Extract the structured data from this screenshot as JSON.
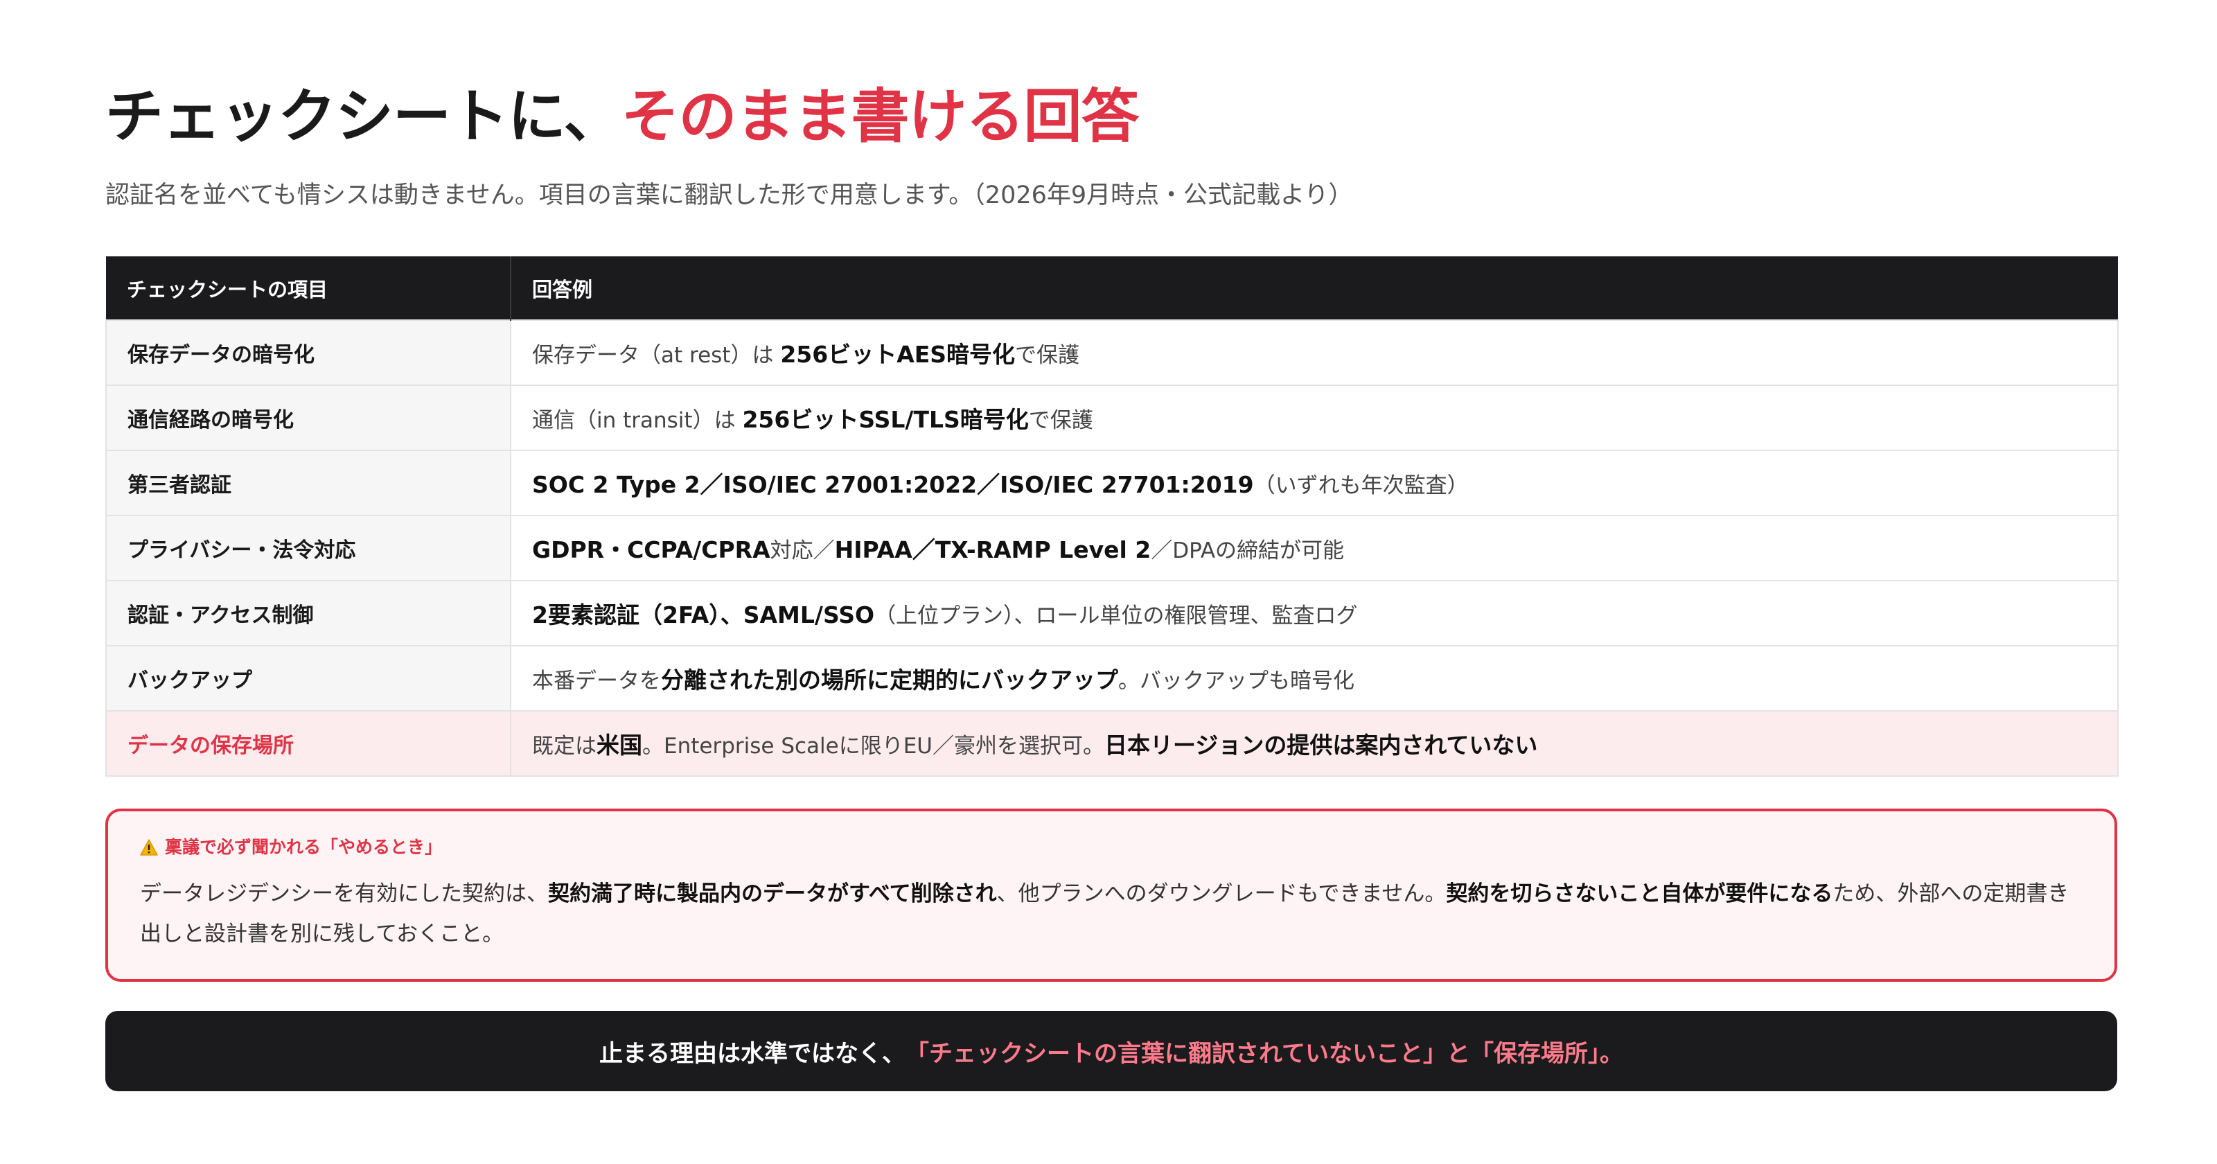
{
  "header": {
    "title_main": "チェックシートに、",
    "title_accent": "そのまま書ける回答",
    "subtitle": "認証名を並べても情シスは動きません。項目の言葉に翻訳した形で用意します。（2026年9月時点・公式記載より）"
  },
  "table": {
    "col_item": "チェックシートの項目",
    "col_answer": "回答例",
    "rows": [
      {
        "item": "保存データの暗号化",
        "parts": [
          {
            "t": "保存データ（at rest）は "
          },
          {
            "t": "256ビットAES暗号化",
            "b": true
          },
          {
            "t": "で保護"
          }
        ]
      },
      {
        "item": "通信経路の暗号化",
        "parts": [
          {
            "t": "通信（in transit）は "
          },
          {
            "t": "256ビットSSL/TLS暗号化",
            "b": true
          },
          {
            "t": "で保護"
          }
        ]
      },
      {
        "item": "第三者認証",
        "parts": [
          {
            "t": "SOC 2 Type 2／ISO/IEC 27001:2022／ISO/IEC 27701:2019",
            "b": true
          },
          {
            "t": "（いずれも年次監査）"
          }
        ]
      },
      {
        "item": "プライバシー・法令対応",
        "parts": [
          {
            "t": "GDPR・CCPA/CPRA",
            "b": true
          },
          {
            "t": "対応／"
          },
          {
            "t": "HIPAA／TX-RAMP Level 2",
            "b": true
          },
          {
            "t": "／DPAの締結が可能"
          }
        ]
      },
      {
        "item": "認証・アクセス制御",
        "parts": [
          {
            "t": "2要素認証（2FA）、SAML/SSO",
            "b": true
          },
          {
            "t": "（上位プラン）、ロール単位の権限管理、監査ログ"
          }
        ]
      },
      {
        "item": "バックアップ",
        "parts": [
          {
            "t": "本番データを"
          },
          {
            "t": "分離された別の場所に定期的にバックアップ",
            "b": true
          },
          {
            "t": "。バックアップも暗号化"
          }
        ]
      },
      {
        "item": "データの保存場所",
        "highlight": true,
        "parts": [
          {
            "t": "既定は"
          },
          {
            "t": "米国",
            "b": true
          },
          {
            "t": "。Enterprise Scaleに限りEU／豪州を選択可。"
          },
          {
            "t": "日本リージョンの提供は案内されていない",
            "b": true
          }
        ]
      }
    ]
  },
  "warning": {
    "icon": "warning-icon",
    "title": "稟議で必ず聞かれる「やめるとき」",
    "parts": [
      {
        "t": "データレジデンシーを有効にした契約は、"
      },
      {
        "t": "契約満了時に製品内のデータがすべて削除され",
        "b": true
      },
      {
        "t": "、他プランへのダウングレードもできません。"
      },
      {
        "t": "契約を切らさないこと自体が要件になる",
        "b": true
      },
      {
        "t": "ため、外部への定期書き出しと設計書を別に残しておくこと。"
      }
    ]
  },
  "footer": {
    "text_before": "止まる理由は水準ではなく、",
    "text_highlight": "「チェックシートの言葉に翻訳されていないこと」と「保存場所」。"
  },
  "colors": {
    "accent": "#e03345",
    "dark": "#1b1b1d",
    "highlight_bg": "#fdecee",
    "footer_highlight": "#ff7a8a"
  }
}
